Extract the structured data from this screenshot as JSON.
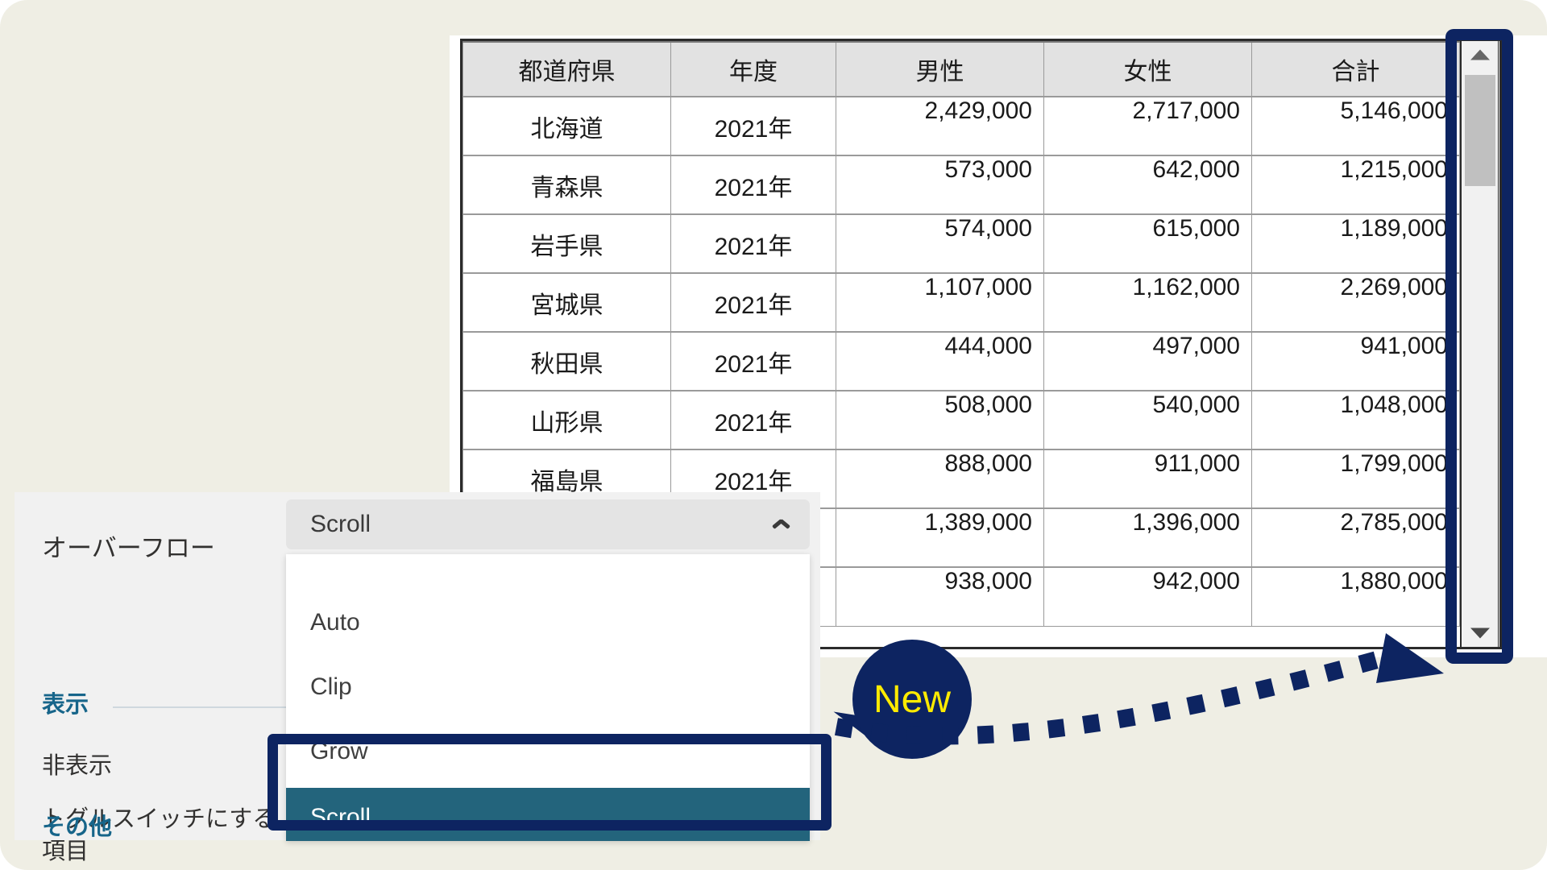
{
  "colors": {
    "page_background": "#efeee4",
    "highlight_navy": "#0d2461",
    "selected_teal": "#23647c",
    "callout_yellow": "#ffeb00",
    "section_heading": "#17658a",
    "scrollbar_thumb": "#c0c0c0",
    "table_header_bg": "#e2e2e2"
  },
  "table": {
    "headers": [
      "都道府県",
      "年度",
      "男性",
      "女性",
      "合計"
    ],
    "rows": [
      {
        "pref": "北海道",
        "year": "2021年",
        "male": "2,429,000",
        "female": "2,717,000",
        "total": "5,146,000"
      },
      {
        "pref": "青森県",
        "year": "2021年",
        "male": "573,000",
        "female": "642,000",
        "total": "1,215,000"
      },
      {
        "pref": "岩手県",
        "year": "2021年",
        "male": "574,000",
        "female": "615,000",
        "total": "1,189,000"
      },
      {
        "pref": "宮城県",
        "year": "2021年",
        "male": "1,107,000",
        "female": "1,162,000",
        "total": "2,269,000"
      },
      {
        "pref": "秋田県",
        "year": "2021年",
        "male": "444,000",
        "female": "497,000",
        "total": "941,000"
      },
      {
        "pref": "山形県",
        "year": "2021年",
        "male": "508,000",
        "female": "540,000",
        "total": "1,048,000"
      },
      {
        "pref": "福島県",
        "year": "2021年",
        "male": "888,000",
        "female": "911,000",
        "total": "1,799,000"
      },
      {
        "pref": "",
        "year": "",
        "male": "1,389,000",
        "female": "1,396,000",
        "total": "2,785,000"
      },
      {
        "pref": "",
        "year": "",
        "male": "938,000",
        "female": "942,000",
        "total": "1,880,000"
      }
    ]
  },
  "scrollbar": {
    "up_arrow": "triangle-up-icon",
    "down_arrow": "triangle-down-icon",
    "thumb_position_percent": 6,
    "thumb_size_percent": 18
  },
  "settings_panel": {
    "overflow_label": "オーバーフロー",
    "section_display": "表示",
    "item_hidden": "非表示",
    "item_toggle": "トグルスイッチにする項目",
    "section_other": "その他"
  },
  "dropdown": {
    "selected_value": "Scroll",
    "chevron": "chevron-up-icon",
    "options": [
      {
        "label": "Auto",
        "selected": false
      },
      {
        "label": "Clip",
        "selected": false
      },
      {
        "label": "Grow",
        "selected": false
      },
      {
        "label": "",
        "selected": false
      },
      {
        "label": "Scroll",
        "selected": true
      }
    ]
  },
  "callout": {
    "badge_text": "New"
  }
}
